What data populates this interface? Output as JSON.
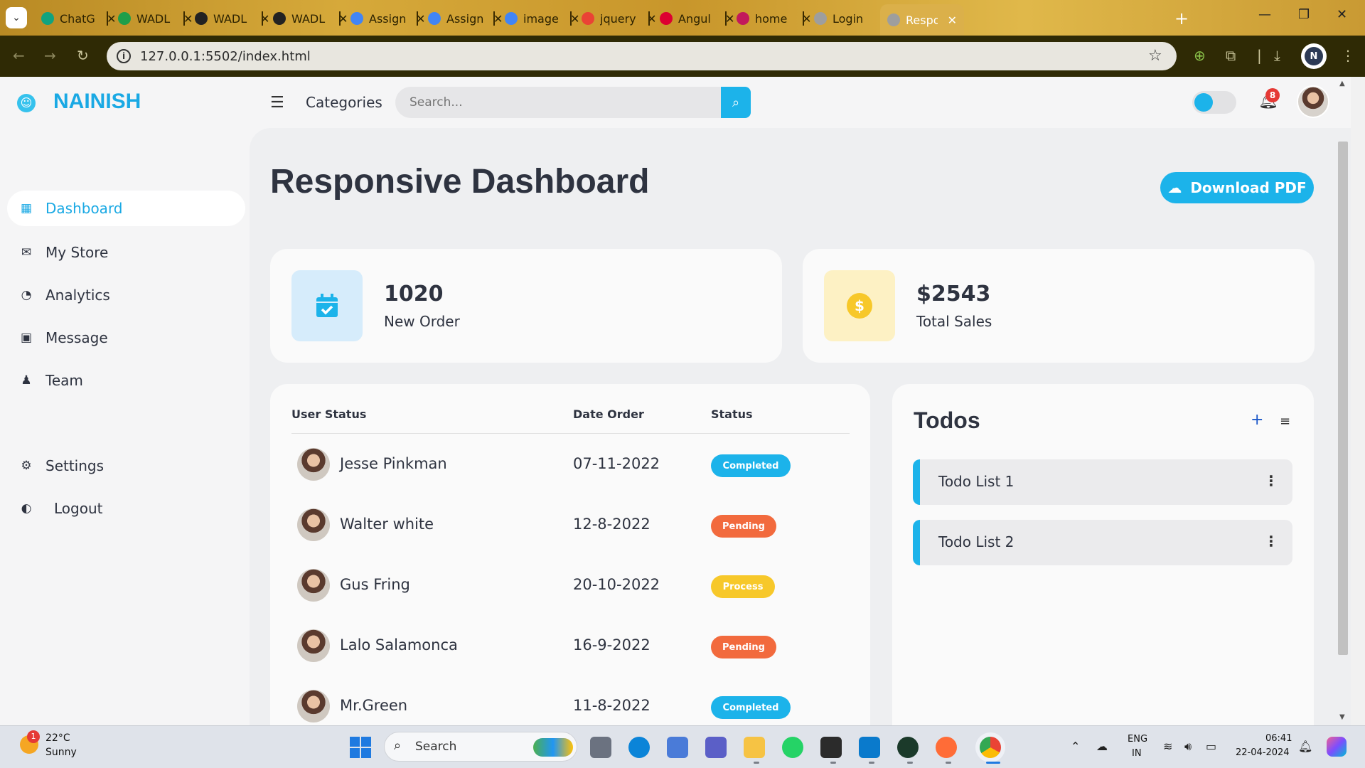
{
  "browser": {
    "tabs": [
      {
        "label": "ChatG",
        "fav": "#10a37f"
      },
      {
        "label": "WADL",
        "fav": "#1e9e4a"
      },
      {
        "label": "WADL",
        "fav": "#222222"
      },
      {
        "label": "WADL",
        "fav": "#222222"
      },
      {
        "label": "Assign",
        "fav": "#4285f4"
      },
      {
        "label": "Assign",
        "fav": "#4285f4"
      },
      {
        "label": "image",
        "fav": "#4285f4"
      },
      {
        "label": "jquery",
        "fav": "#ea4335"
      },
      {
        "label": "Angul",
        "fav": "#dd0031"
      },
      {
        "label": "home",
        "fav": "#c2185b"
      },
      {
        "label": "Login",
        "fav": "#9e9e9e"
      },
      {
        "label": "Respo",
        "fav": "#9e9e9e"
      }
    ],
    "url": "127.0.0.1:5502/index.html",
    "profile_initial": "N"
  },
  "brand": {
    "name": "NAINISH"
  },
  "header": {
    "categories": "Categories",
    "search_placeholder": "Search...",
    "notification_count": "8"
  },
  "sidebar": {
    "items": [
      {
        "label": "Dashboard",
        "icon": "grid-icon"
      },
      {
        "label": "My Store",
        "icon": "store-icon"
      },
      {
        "label": "Analytics",
        "icon": "analytics-icon"
      },
      {
        "label": "Message",
        "icon": "message-icon"
      },
      {
        "label": "Team",
        "icon": "team-icon"
      },
      {
        "label": "Settings",
        "icon": "gear-icon"
      },
      {
        "label": "Logout",
        "icon": "logout-icon"
      }
    ]
  },
  "main": {
    "title": "Responsive Dashboard",
    "download_label": "Download PDF",
    "stats": [
      {
        "value": "1020",
        "label": "New Order",
        "color": "#d6ecfb"
      },
      {
        "value": "$2543",
        "label": "Total Sales",
        "color": "#fdf1c4"
      }
    ],
    "table": {
      "headers": [
        "User Status",
        "Date Order",
        "Status"
      ],
      "rows": [
        {
          "name": "Jesse Pinkman",
          "date": "07-11-2022",
          "status": "Completed",
          "color": "#1cb3ea"
        },
        {
          "name": "Walter white",
          "date": "12-8-2022",
          "status": "Pending",
          "color": "#f26a3d"
        },
        {
          "name": "Gus Fring",
          "date": "20-10-2022",
          "status": "Process",
          "color": "#f7c82a"
        },
        {
          "name": "Lalo Salamonca",
          "date": "16-9-2022",
          "status": "Pending",
          "color": "#f26a3d"
        },
        {
          "name": "Mr.Green",
          "date": "11-8-2022",
          "status": "Completed",
          "color": "#1cb3ea"
        }
      ]
    },
    "todos": {
      "title": "Todos",
      "items": [
        "Todo List 1",
        "Todo List 2"
      ]
    }
  },
  "taskbar": {
    "weather_badge": "1",
    "temp": "22°C",
    "condition": "Sunny",
    "search_label": "Search",
    "lang1": "ENG",
    "lang2": "IN",
    "time": "06:41",
    "date": "22-04-2024"
  }
}
